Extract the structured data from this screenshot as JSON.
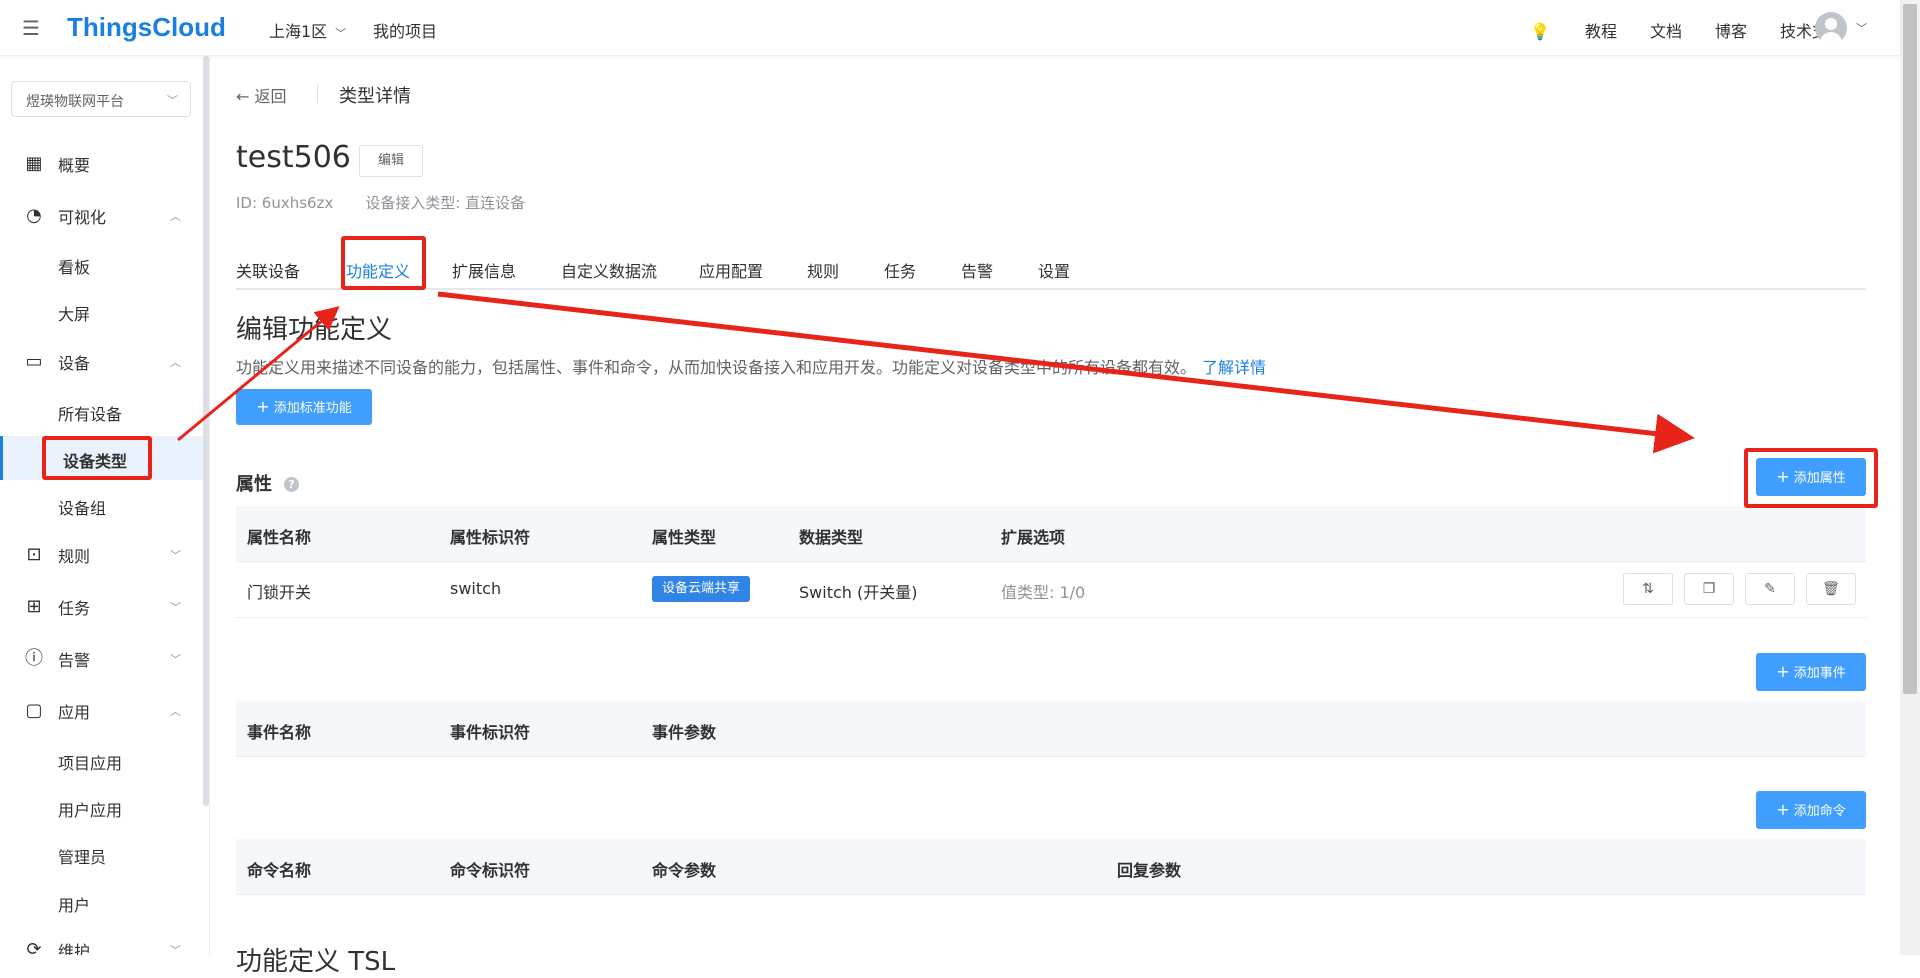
{
  "header": {
    "logo": "ThingsCloud",
    "region": "上海1区",
    "my_projects": "我的项目",
    "nav": [
      "教程",
      "文档",
      "博客",
      "技术支持"
    ]
  },
  "sidebar": {
    "platform": "煜瑛物联网平台",
    "items": [
      {
        "label": "概要",
        "icon": "dashboard-grid-icon"
      },
      {
        "label": "可视化",
        "icon": "gauge-icon",
        "expanded": true
      },
      {
        "label": "看板"
      },
      {
        "label": "大屏"
      },
      {
        "label": "设备",
        "icon": "device-icon",
        "expanded": true
      },
      {
        "label": "所有设备"
      },
      {
        "label": "设备类型",
        "active": true
      },
      {
        "label": "设备组"
      },
      {
        "label": "规则",
        "icon": "terminal-icon"
      },
      {
        "label": "任务",
        "icon": "task-clock-icon"
      },
      {
        "label": "告警",
        "icon": "alert-circle-icon"
      },
      {
        "label": "应用",
        "icon": "app-window-icon",
        "expanded": true
      },
      {
        "label": "项目应用"
      },
      {
        "label": "用户应用"
      },
      {
        "label": "管理员"
      },
      {
        "label": "用户"
      },
      {
        "label": "维护",
        "icon": "maintenance-icon"
      }
    ]
  },
  "page": {
    "back_label": "返回",
    "breadcrumb": "类型详情",
    "type_name": "test506",
    "edit_label": "编辑",
    "id_text": "ID: 6uxhs6zx",
    "access_type": "设备接入类型: 直连设备",
    "tabs": [
      "关联设备",
      "功能定义",
      "扩展信息",
      "自定义数据流",
      "应用配置",
      "规则",
      "任务",
      "告警",
      "设置"
    ],
    "active_tab": "功能定义",
    "section_title": "编辑功能定义",
    "section_desc": "功能定义用来描述不同设备的能力，包括属性、事件和命令，从而加快设备接入和应用开发。功能定义对设备类型中的所有设备都有效。",
    "learn_more": "了解详情",
    "add_standard": "添加标准功能",
    "properties": {
      "title": "属性",
      "add_label": "添加属性",
      "columns": [
        "属性名称",
        "属性标识符",
        "属性类型",
        "数据类型",
        "扩展选项"
      ],
      "rows": [
        {
          "name": "门锁开关",
          "identifier": "switch",
          "type": "设备云端共享",
          "data_type": "Switch (开关量)",
          "ext": "值类型: 1/0"
        }
      ]
    },
    "events": {
      "title": "事件",
      "add_label": "添加事件",
      "columns": [
        "事件名称",
        "事件标识符",
        "事件参数"
      ]
    },
    "commands": {
      "title": "命令",
      "add_label": "添加命令",
      "columns": [
        "命令名称",
        "命令标识符",
        "命令参数",
        "回复参数"
      ]
    },
    "bottom_title": "功能定义 TSL"
  },
  "colors": {
    "brand": "#1a7fe0",
    "primary_button": "#409eff",
    "annotation_red": "#e8231a"
  }
}
